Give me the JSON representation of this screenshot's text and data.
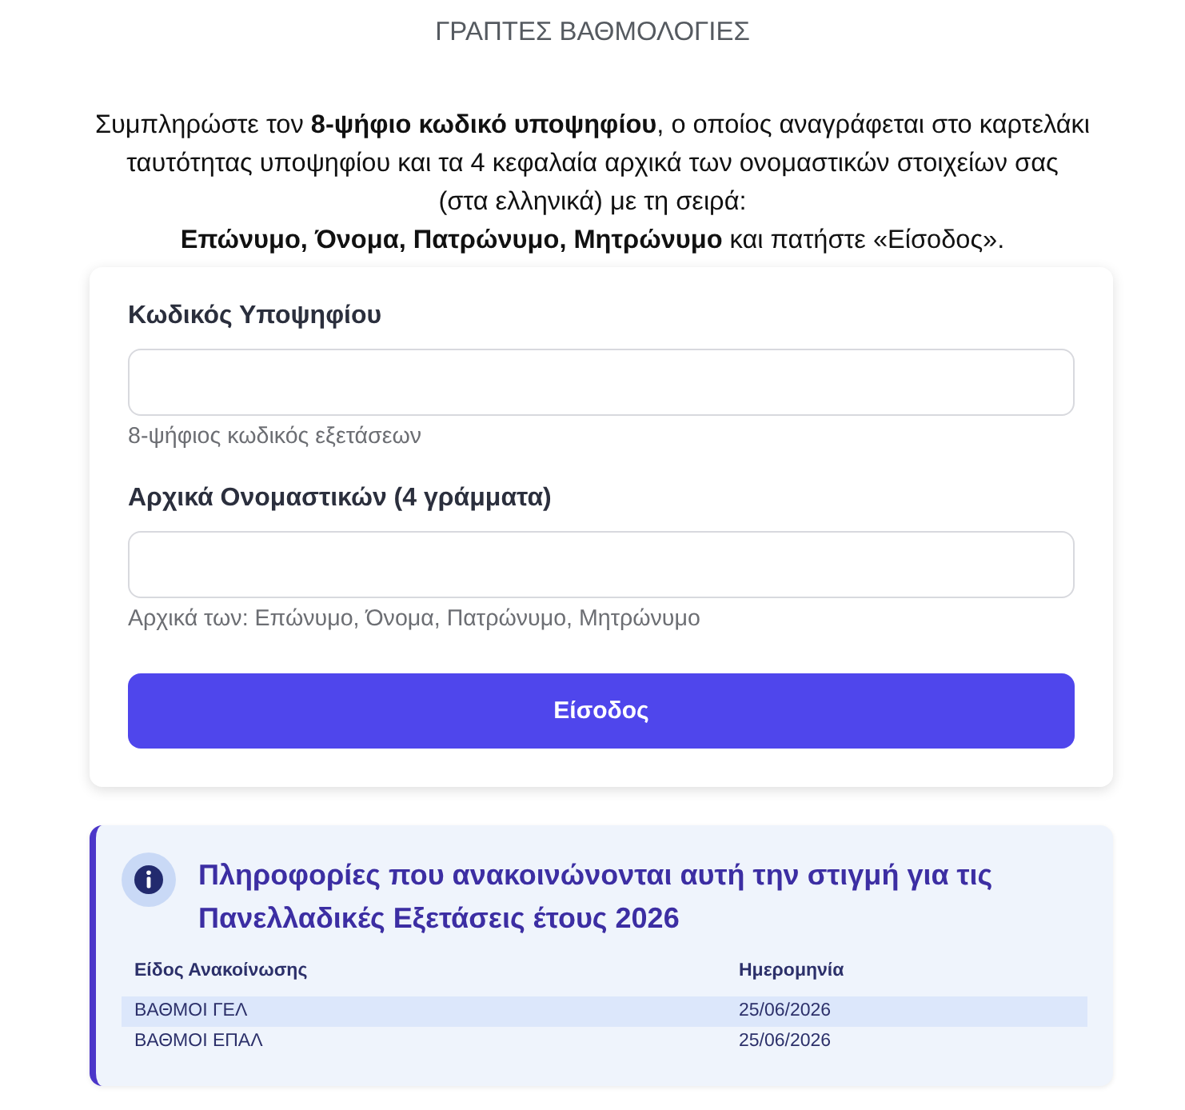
{
  "page": {
    "title": "ΓΡΑΠΤΕΣ ΒΑΘΜΟΛΟΓΙΕΣ"
  },
  "instructions": "Συμπληρώστε τον **8-ψήφιο κωδικό υποψηφίου**, ο οποίος αναγράφεται στο καρτελάκι\nταυτότητας υποψηφίου και τα 4 κεφαλαία αρχικά των ονομαστικών στοιχείων σας\n(στα ελληνικά) με τη σειρά:\n**Επώνυμο, Όνομα, Πατρώνυμο, Μητρώνυμο** και πατήστε «Είσοδος».",
  "form": {
    "fields": [
      {
        "label": "Κωδικός Υποψηφίου",
        "hint": "8-ψήφιος κωδικός εξετάσεων"
      },
      {
        "label": "Αρχικά Ονομαστικών (4 γράμματα)",
        "hint": "Αρχικά των: Επώνυμο, Όνομα, Πατρώνυμο, Μητρώνυμο"
      }
    ],
    "submit_button": "Είσοδος"
  },
  "announcements": {
    "title": "Πληροφορίες που ανακοινώνονται αυτή την στιγμή για τις Πανελλαδικές Εξετάσεις έτους 2026",
    "table": {
      "columns": [
        "Είδος Ανακοίνωσης",
        "Ημερομηνία"
      ],
      "rows": [
        {
          "cells": [
            "ΒΑΘΜΟΙ ΓΕΛ",
            "25/06/2026"
          ],
          "selected": true
        },
        {
          "cells": [
            "ΒΑΘΜΟΙ ΕΠΑΛ",
            "25/06/2026"
          ],
          "selected": false
        }
      ]
    }
  }
}
